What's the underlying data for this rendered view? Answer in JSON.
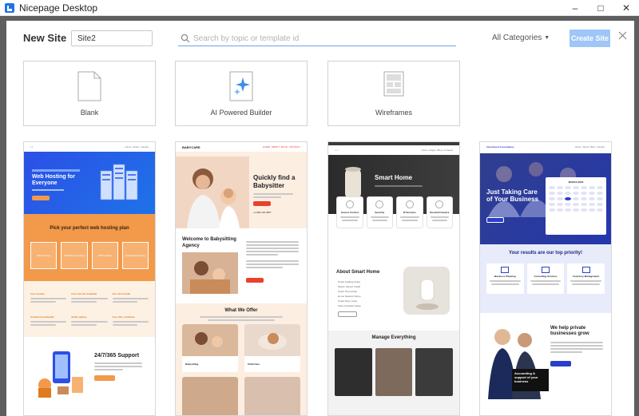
{
  "window": {
    "title": "Nicepage Desktop",
    "controls": {
      "minimize": "–",
      "maximize": "□",
      "close": "✕"
    }
  },
  "dialog": {
    "title": "New Site",
    "site_name": "Site2",
    "search_placeholder": "Search by topic or template id",
    "categories": "All Categories",
    "create_button": "Create Site"
  },
  "options": [
    {
      "label": "Blank",
      "icon": "blank-page-icon"
    },
    {
      "label": "AI Powered Builder",
      "icon": "ai-sparkle-icon"
    },
    {
      "label": "Wireframes",
      "icon": "wireframe-icon"
    }
  ],
  "templates": {
    "hosting": {
      "hero_title": "Web Hosting for Everyone",
      "plan_heading": "Pick your perfect web hosting plan",
      "plans": [
        "Web Hosting",
        "WordPress Hosting",
        "VPS Hosting",
        "Dedicated Hosting"
      ],
      "features": [
        "Free domain",
        "Free transfer available",
        "Our click install",
        "Unlimited bandwidth",
        "99.9% uptime",
        "Free SSL certificate"
      ],
      "support": "24/7/365 Support"
    },
    "babysitter": {
      "brand": "BABYCARE",
      "hero_title": "Quickly find a Babysitter",
      "phone": "+1 800 123 4567",
      "welcome": "Welcome to Babysitting Agency",
      "offer_heading": "What We Offer",
      "services": [
        "Babysitting",
        "Child Care"
      ]
    },
    "smarthome": {
      "hero_title": "Smart Home",
      "features": [
        "Access Control",
        "Security",
        "IP Services",
        "Doorbell Camera"
      ],
      "about": "About Smart Home",
      "about_list": [
        "Smart Lighting Setup",
        "Motion Sensor Install",
        "Smart Thermostat",
        "Home Network Setup",
        "Smart Door Locks",
        "Voice Assistant Setup"
      ],
      "manage": "Manage Everything"
    },
    "consulting": {
      "brand": "Investment Consultancy",
      "hero_title": "Just Taking Care of Your Business",
      "calendar_month": "MARCH 2023",
      "priority": "Your results are our top priority!",
      "services": [
        "Business Planning",
        "Consulting Services",
        "Inventory Management"
      ],
      "help": "We help private businesses grow",
      "badge": "Accounting & support of your business"
    }
  },
  "colors": {
    "accent": "#1e73e8",
    "create_disabled": "#9ec6f6",
    "orange": "#f2994a",
    "babysitter_red": "#e8412c",
    "consult_blue": "#2a3fc9"
  }
}
